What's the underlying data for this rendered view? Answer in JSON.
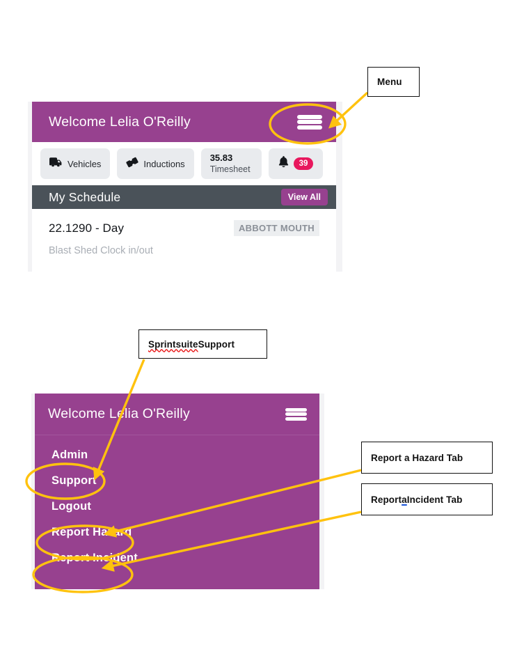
{
  "colors": {
    "brand_purple": "#97418F",
    "dark_slate": "#4A5259",
    "badge_pink": "#E8175D",
    "annotation_yellow": "#FFC20E",
    "tile_gray": "#E9EBEE",
    "page_gray": "#F3F3F5"
  },
  "annotations": [
    {
      "id": "menu",
      "label": "Menu"
    },
    {
      "id": "support",
      "label_before": "Sprintsuite",
      "label_after": " Support",
      "misspelled": "Sprintsuite"
    },
    {
      "id": "hazard",
      "label": "Report a Hazard Tab"
    },
    {
      "id": "incident",
      "label_before": "Report ",
      "label_mid": "a",
      "label_after": " Incident Tab",
      "grammar_flag": "a"
    }
  ],
  "dashboard": {
    "header": {
      "welcome": "Welcome Lelia O'Reilly",
      "menu_icon": "hamburger-icon"
    },
    "quick_actions": [
      {
        "icon": "truck-icon",
        "label": "Vehicles"
      },
      {
        "icon": "ticket-icon",
        "label": "Inductions"
      },
      {
        "icon": "",
        "value": "35.83",
        "caption": "Timesheet"
      },
      {
        "icon": "bell-icon",
        "badge": "39"
      }
    ],
    "schedule": {
      "section_title": "My Schedule",
      "view_all_label": "View All",
      "entry_title": "22.1290 - Day",
      "entry_site": "ABBOTT MOUTH",
      "entry_subtitle": "Blast Shed Clock in/out"
    }
  },
  "menu_screen": {
    "header": {
      "welcome": "Welcome Lelia O'Reilly",
      "menu_icon": "hamburger-icon"
    },
    "items": [
      {
        "label": "Admin"
      },
      {
        "label": "Support"
      },
      {
        "label": "Logout"
      },
      {
        "label": "Report Hazard"
      },
      {
        "label": "Report Incident"
      }
    ]
  }
}
